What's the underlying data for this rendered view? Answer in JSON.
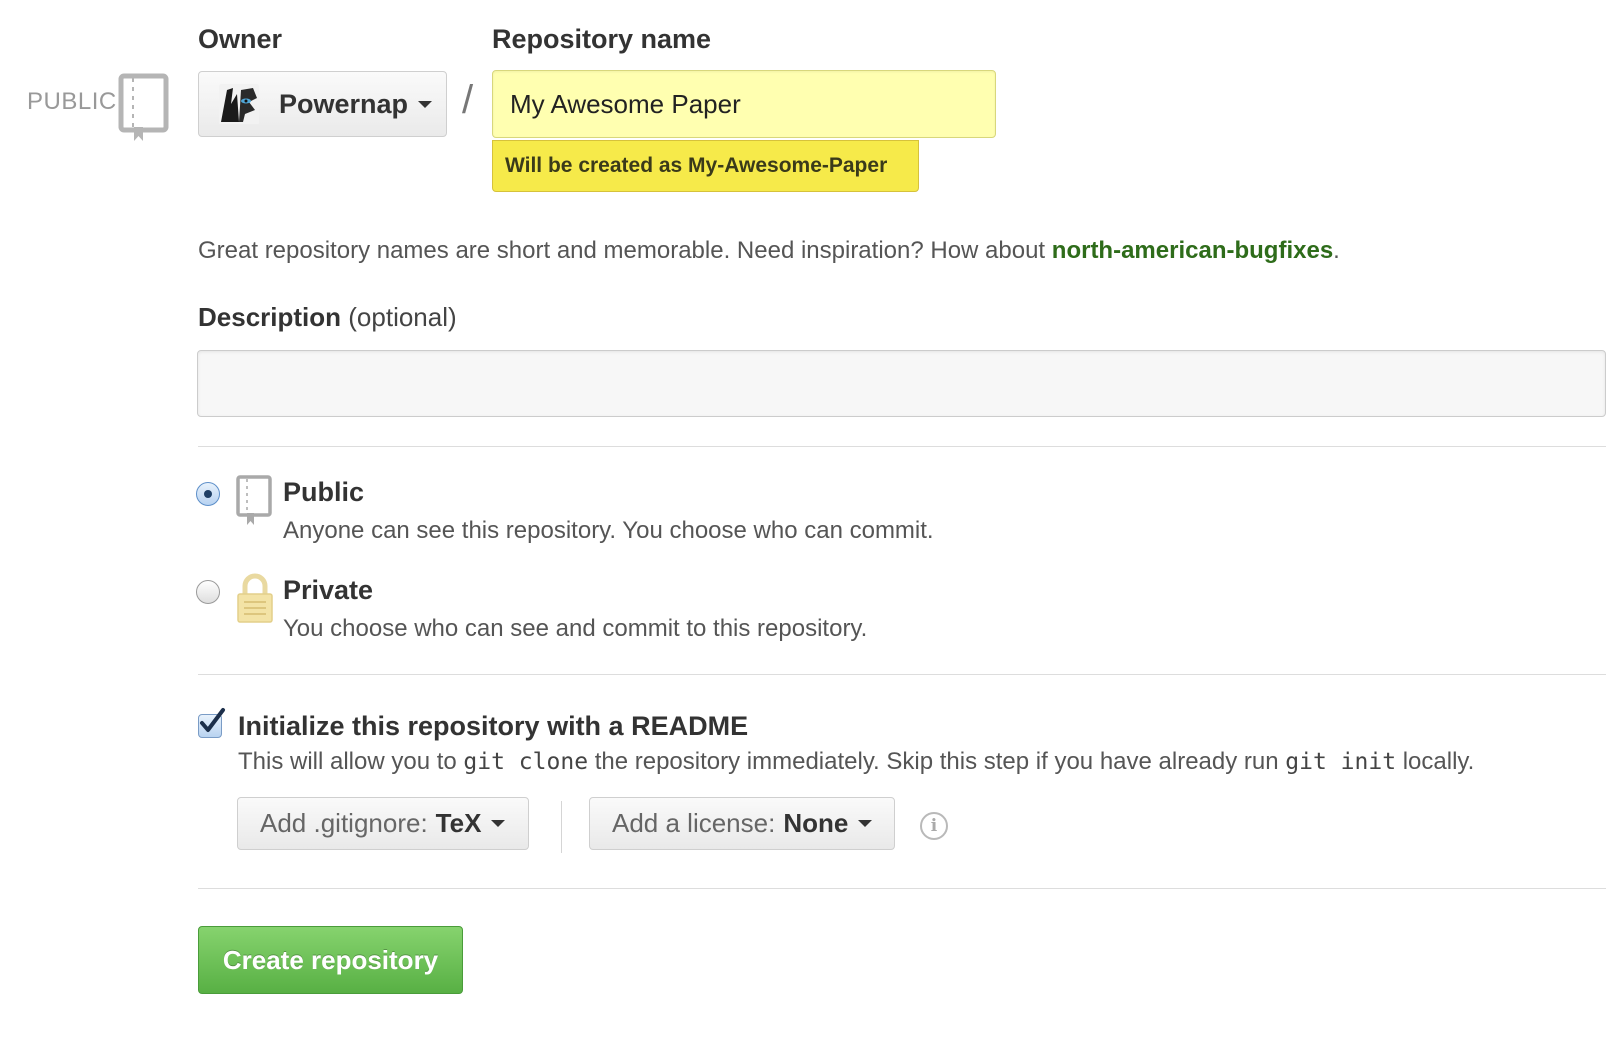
{
  "owner": {
    "label": "Owner",
    "name": "Powernap"
  },
  "repo_name": {
    "label": "Repository name",
    "value": "My Awesome Paper",
    "hint": "Will be created as My-Awesome-Paper"
  },
  "visibility_tag": "PUBLIC",
  "separator": "/",
  "helper": {
    "text": "Great repository names are short and memorable. Need inspiration? How about ",
    "suggestion": "north-american-bugfixes",
    "suffix": "."
  },
  "description": {
    "label": "Description",
    "optional": "(optional)",
    "value": ""
  },
  "visibility": {
    "public": {
      "title": "Public",
      "desc": "Anyone can see this repository. You choose who can commit.",
      "selected": true
    },
    "private": {
      "title": "Private",
      "desc": "You choose who can see and commit to this repository.",
      "selected": false
    }
  },
  "readme": {
    "title": "Initialize this repository with a README",
    "checked": true,
    "desc_1": "This will allow you to ",
    "code_1": "git clone",
    "desc_2": " the repository immediately. Skip this step if you have already run ",
    "code_2": "git init",
    "desc_3": " locally."
  },
  "gitignore": {
    "label": "Add .gitignore:",
    "value": "TeX"
  },
  "license": {
    "label": "Add a license:",
    "value": "None"
  },
  "info_icon": "i",
  "create_button": "Create repository"
}
